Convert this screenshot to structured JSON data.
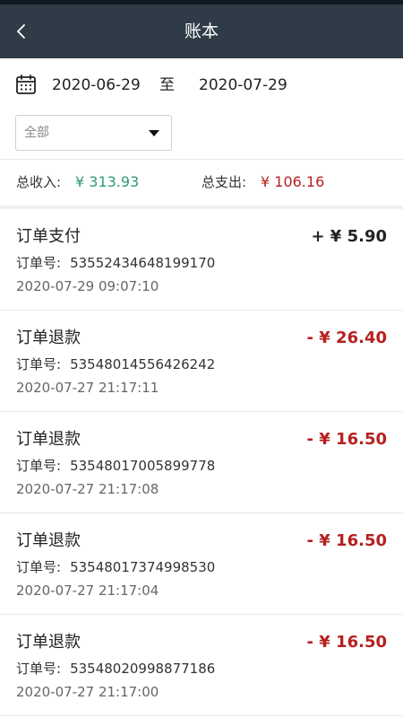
{
  "header": {
    "title": "账本",
    "back_icon": "chevron-left-icon"
  },
  "date_range": {
    "start": "2020-06-29",
    "separator": "至",
    "end": "2020-07-29",
    "icon": "calendar-icon"
  },
  "filter": {
    "selected": "全部"
  },
  "summary": {
    "income_label": "总收入:",
    "income_value": "¥ 313.93",
    "expense_label": "总支出:",
    "expense_value": "¥ 106.16"
  },
  "colors": {
    "navbar": "#2f3c47",
    "income": "#2f9a73",
    "expense": "#b62020"
  },
  "transactions": [
    {
      "type": "订单支付",
      "amount": "+ ¥ 5.90",
      "direction": "in",
      "order_label": "订单号:",
      "order_no": "53552434648199170",
      "time": "2020-07-29 09:07:10"
    },
    {
      "type": "订单退款",
      "amount": "- ¥ 26.40",
      "direction": "out",
      "order_label": "订单号:",
      "order_no": "53548014556426242",
      "time": "2020-07-27 21:17:11"
    },
    {
      "type": "订单退款",
      "amount": "- ¥ 16.50",
      "direction": "out",
      "order_label": "订单号:",
      "order_no": "53548017005899778",
      "time": "2020-07-27 21:17:08"
    },
    {
      "type": "订单退款",
      "amount": "- ¥ 16.50",
      "direction": "out",
      "order_label": "订单号:",
      "order_no": "53548017374998530",
      "time": "2020-07-27 21:17:04"
    },
    {
      "type": "订单退款",
      "amount": "- ¥ 16.50",
      "direction": "out",
      "order_label": "订单号:",
      "order_no": "53548020998877186",
      "time": "2020-07-27 21:17:00"
    }
  ]
}
